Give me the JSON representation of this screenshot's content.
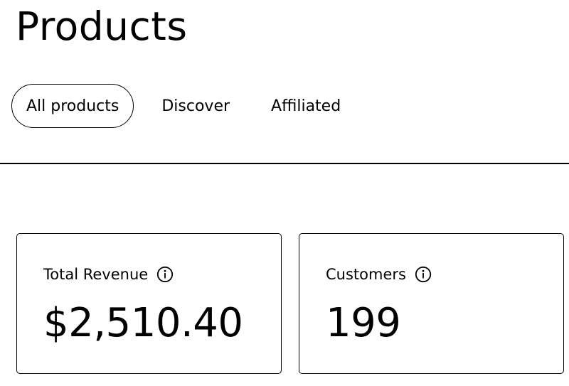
{
  "header": {
    "title": "Products"
  },
  "tabs": [
    {
      "label": "All products",
      "active": true
    },
    {
      "label": "Discover",
      "active": false
    },
    {
      "label": "Affiliated",
      "active": false
    }
  ],
  "stats": {
    "revenue": {
      "label": "Total Revenue",
      "value": "$2,510.40",
      "icon": "info-icon"
    },
    "customers": {
      "label": "Customers",
      "value": "199",
      "icon": "info-icon"
    }
  },
  "colors": {
    "text": "#000000",
    "background": "#ffffff",
    "border": "#000000"
  }
}
